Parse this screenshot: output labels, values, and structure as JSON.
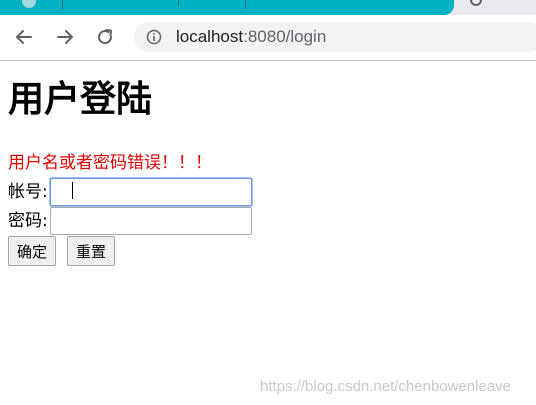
{
  "browser": {
    "url_host": "localhost",
    "url_rest": ":8080/login",
    "back_icon": "arrow-left-icon",
    "forward_icon": "arrow-right-icon",
    "reload_icon": "reload-icon",
    "info_icon": "info-icon"
  },
  "page": {
    "title": "用户登陆",
    "error_message": "用户名或者密码错误！！！",
    "username_label": "帐号:",
    "username_value": "",
    "password_label": "密码:",
    "password_value": "",
    "submit_label": "确定",
    "reset_label": "重置"
  },
  "watermark": "https://blog.csdn.net/chenbowenleave",
  "colors": {
    "tab_accent": "#00b2c1",
    "error": "#e00000",
    "focus_border": "#6c9bdb"
  }
}
